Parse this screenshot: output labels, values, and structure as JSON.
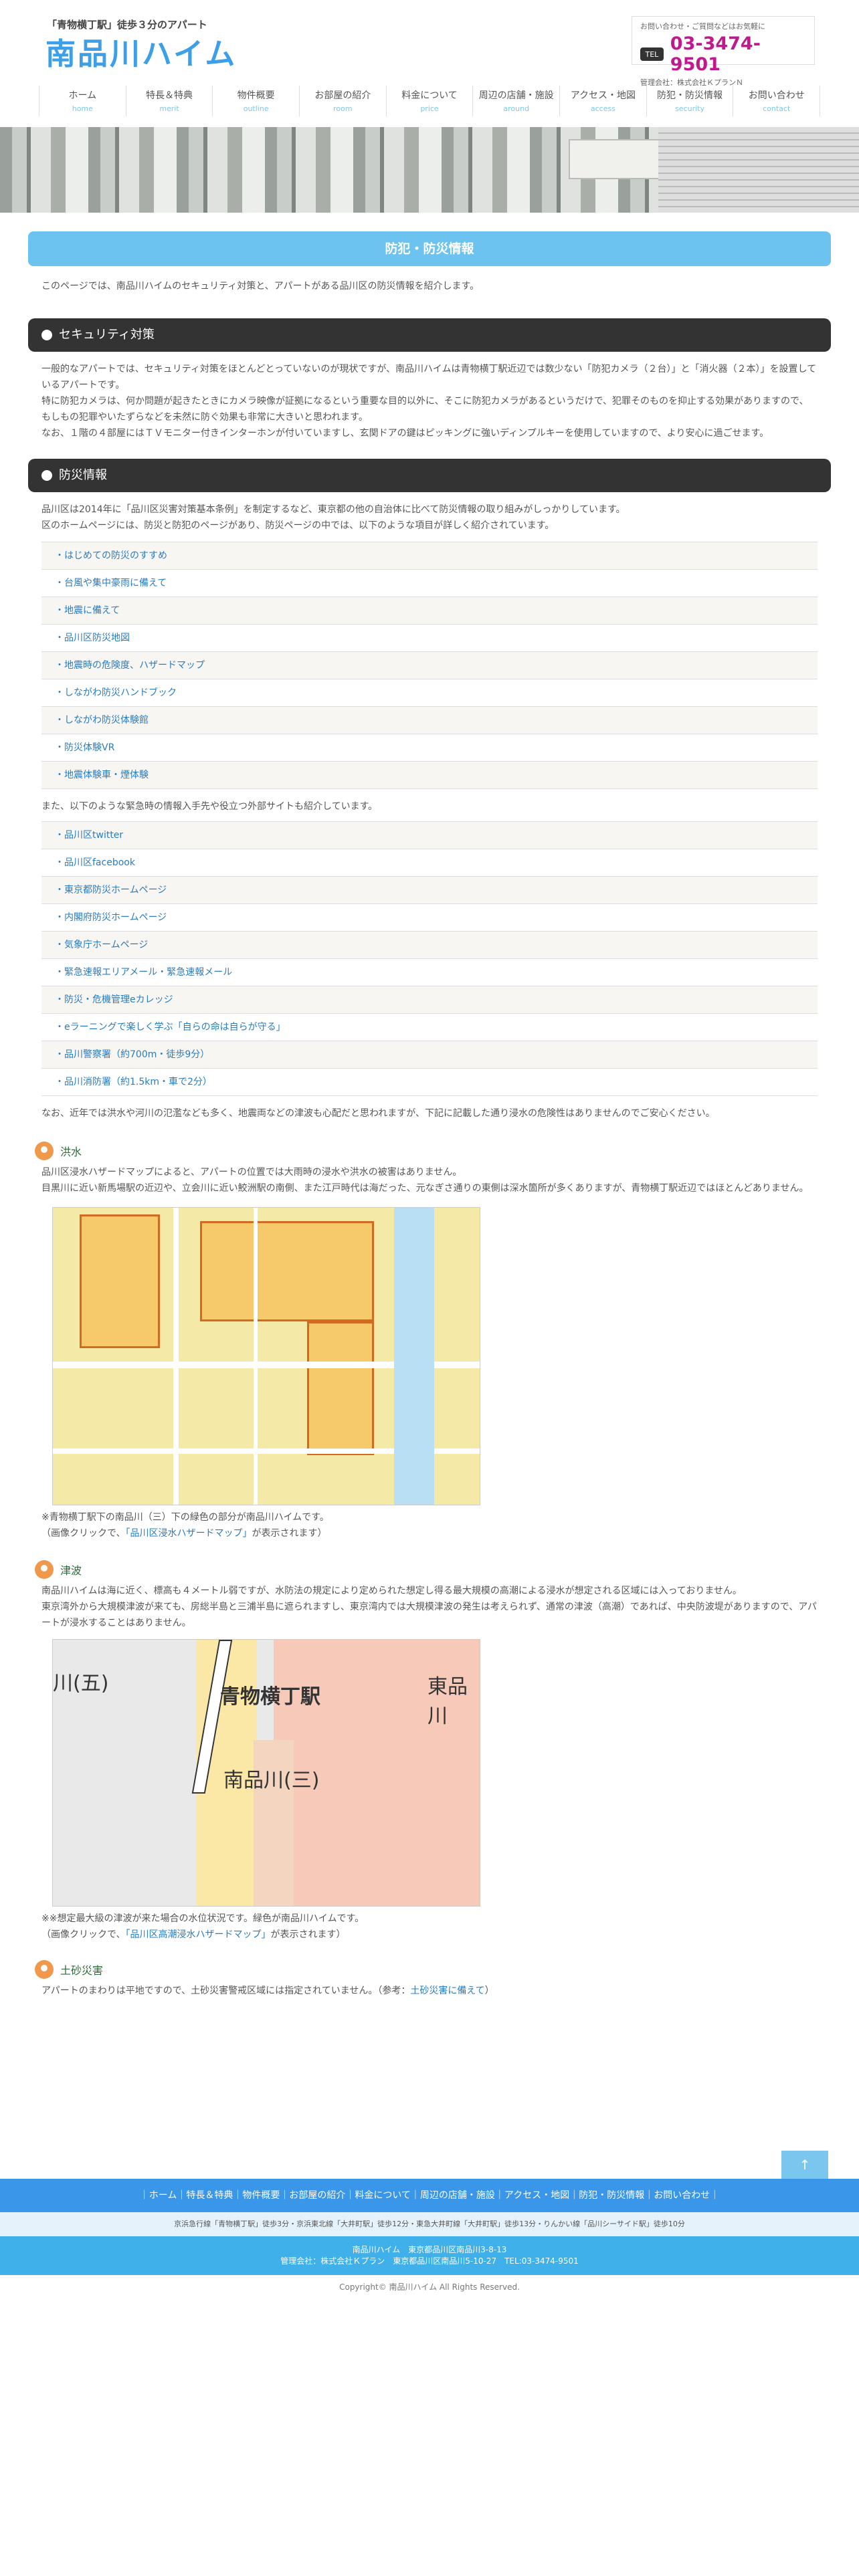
{
  "header": {
    "tagline": "「青物横丁駅」徒歩３分のアパート",
    "site_title": "南品川ハイム",
    "contact_note": "お問い合わせ・ご質問などはお気軽に",
    "tel_icon_label": "TEL",
    "phone": "03-3474-9501",
    "manager": "管理会社：株式会社ＫプランＮ"
  },
  "nav": [
    {
      "jp": "ホーム",
      "en": "home"
    },
    {
      "jp": "特長＆特典",
      "en": "merit"
    },
    {
      "jp": "物件概要",
      "en": "outline"
    },
    {
      "jp": "お部屋の紹介",
      "en": "room"
    },
    {
      "jp": "料金について",
      "en": "price"
    },
    {
      "jp": "周辺の店舗・施設",
      "en": "around"
    },
    {
      "jp": "アクセス・地図",
      "en": "access"
    },
    {
      "jp": "防犯・防災情報",
      "en": "security"
    },
    {
      "jp": "お問い合わせ",
      "en": "contact"
    }
  ],
  "page": {
    "title": "防犯・防災情報",
    "intro": "このページでは、南品川ハイムのセキュリティ対策と、アパートがある品川区の防災情報を紹介します。"
  },
  "security": {
    "heading": "セキュリティ対策",
    "paragraphs": [
      "一般的なアパートでは、セキュリティ対策をほとんどとっていないのが現状ですが、南品川ハイムは青物横丁駅近辺では数少ない「防犯カメラ（２台）」と「消火器（２本）」を設置しているアパートです。",
      "特に防犯カメラは、何か問題が起きたときにカメラ映像が証拠になるという重要な目的以外に、そこに防犯カメラがあるというだけで、犯罪そのものを抑止する効果がありますので、もしもの犯罪やいたずらなどを未然に防ぐ効果も非常に大きいと思われます。",
      "なお、１階の４部屋にはＴＶモニター付きインターホンが付いていますし、玄関ドアの鍵はピッキングに強いディンプルキーを使用していますので、より安心に過ごせます。"
    ]
  },
  "disaster": {
    "heading": "防災情報",
    "intro1": "品川区は2014年に「品川区災害対策基本条例」を制定するなど、東京都の他の自治体に比べて防災情報の取り組みがしっかりしています。",
    "intro2": "区のホームページには、防災と防犯のページがあり、防災ページの中では、以下のような項目が詳しく紹介されています。",
    "list1": [
      "・はじめての防災のすすめ",
      "・台風や集中豪雨に備えて",
      "・地震に備えて",
      "・品川区防災地図",
      "・地震時の危険度、ハザードマップ",
      "・しながわ防災ハンドブック",
      "・しながわ防災体験館",
      "・防災体験VR",
      "・地震体験車・煙体験"
    ],
    "middle": "また、以下のような緊急時の情報入手先や役立つ外部サイトも紹介しています。",
    "list2": [
      "・品川区twitter",
      "・品川区facebook",
      "・東京都防災ホームページ",
      "・内閣府防災ホームページ",
      "・気象庁ホームページ",
      "・緊急速報エリアメール・緊急速報メール",
      "・防災・危機管理eカレッジ",
      "・eラーニングで楽しく学ぶ「自らの命は自らが守る」",
      "・品川警察署（約700m・徒歩9分）",
      "・品川消防署（約1.5km・車で2分）"
    ],
    "after": "なお、近年では洪水や河川の氾濫なども多く、地震両などの津波も心配だと思われますが、下記に記載した通り浸水の危険性はありませんのでご安心ください。"
  },
  "flood": {
    "heading": "洪水",
    "p1": "品川区浸水ハザードマップによると、アパートの位置では大雨時の浸水や洪水の被害はありません。",
    "p2": "目黒川に近い新馬場駅の近辺や、立会川に近い鮫洲駅の南側、また江戸時代は海だった、元なぎさ通りの東側は深水箇所が多くありますが、青物横丁駅近辺ではほとんどありません。",
    "cap1": "※青物横丁駅下の南品川（三）下の緑色の部分が南品川ハイムです。",
    "cap2_pre": "（画像クリックで、",
    "cap2_link": "「品川区浸水ハザードマップ」",
    "cap2_post": "が表示されます）"
  },
  "tsunami": {
    "heading": "津波",
    "p1": "南品川ハイムは海に近く、標高も４メートル弱ですが、水防法の規定により定められた想定し得る最大規模の高潮による浸水が想定される区域には入っておりません。",
    "p2": "東京湾外から大規模津波が来ても、房総半島と三浦半島に遮られますし、東京湾内では大規模津波の発生は考えられず、通常の津波（高潮）であれば、中央防波堤がありますので、アパートが浸水することはありません。",
    "map_label_station": "青物横丁駅",
    "map_label_area": "南品川(三)",
    "map_label_east": "東品川",
    "map_label_left": "川(五)",
    "cap1": "※※想定最大級の津波が来た場合の水位状況です。緑色が南品川ハイムです。",
    "cap2_pre": "（画像クリックで、",
    "cap2_link": "「品川区高潮浸水ハザードマップ」",
    "cap2_post": "が表示されます）"
  },
  "landslide": {
    "heading": "土砂災害",
    "text_pre": "アパートのまわりは平地ですので、土砂災害警戒区域には指定されていません。（参考：",
    "link": "土砂災害に備えて",
    "text_post": "）"
  },
  "footer": {
    "to_top": "↑",
    "nav": "｜ホーム｜特長＆特典｜物件概要｜お部屋の紹介｜料金について｜周辺の店舗・施設｜アクセス・地図｜防犯・防災情報｜お問い合わせ｜",
    "access": "京浜急行線「青物横丁駅」徒歩3分・京浜東北線「大井町駅」徒歩12分・東急大井町線「大井町駅」徒歩13分・りんかい線「品川シーサイド駅」徒歩10分",
    "info1": "南品川ハイム　東京都品川区南品川3-8-13",
    "info2": "管理会社：株式会社Ｋプラン　東京都品川区南品川5-10-27　TEL:03-3474-9501",
    "copyright": "Copyright© 南品川ハイム All Rights Reserved."
  }
}
